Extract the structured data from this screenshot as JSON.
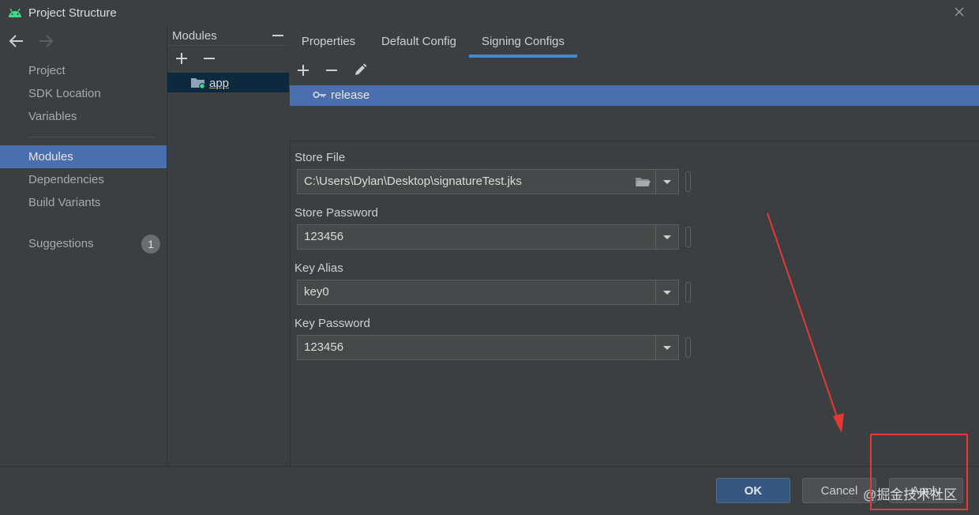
{
  "window": {
    "title": "Project Structure"
  },
  "sidebar": {
    "items": [
      {
        "label": "Project"
      },
      {
        "label": "SDK Location"
      },
      {
        "label": "Variables"
      },
      {
        "label": "Modules"
      },
      {
        "label": "Dependencies"
      },
      {
        "label": "Build Variants"
      },
      {
        "label": "Suggestions",
        "badge": "1"
      }
    ],
    "selected": "Modules"
  },
  "modules": {
    "header": "Modules",
    "items": [
      {
        "label": "app"
      }
    ]
  },
  "tabs": [
    {
      "label": "Properties"
    },
    {
      "label": "Default Config"
    },
    {
      "label": "Signing Configs",
      "active": true
    }
  ],
  "signing": {
    "configs": [
      {
        "label": "release"
      }
    ],
    "fields": {
      "store_file": {
        "label": "Store File",
        "value": "C:\\Users\\Dylan\\Desktop\\signatureTest.jks"
      },
      "store_password": {
        "label": "Store Password",
        "value": "123456"
      },
      "key_alias": {
        "label": "Key Alias",
        "value": "key0"
      },
      "key_password": {
        "label": "Key Password",
        "value": "123456"
      }
    }
  },
  "buttons": {
    "ok": "OK",
    "cancel": "Cancel",
    "apply": "Apply"
  },
  "watermark": "@掘金技术社区",
  "colors": {
    "background": "#3c3f41",
    "selection": "#4b6eaf",
    "accent_underline": "#4a88c7",
    "annotation": "#e53935"
  },
  "icons": [
    "android-icon",
    "close-icon",
    "arrow-left-icon",
    "arrow-right-icon",
    "plus-icon",
    "minus-icon",
    "pencil-icon",
    "key-icon",
    "module-folder-icon",
    "folder-icon",
    "chevron-down-icon"
  ]
}
